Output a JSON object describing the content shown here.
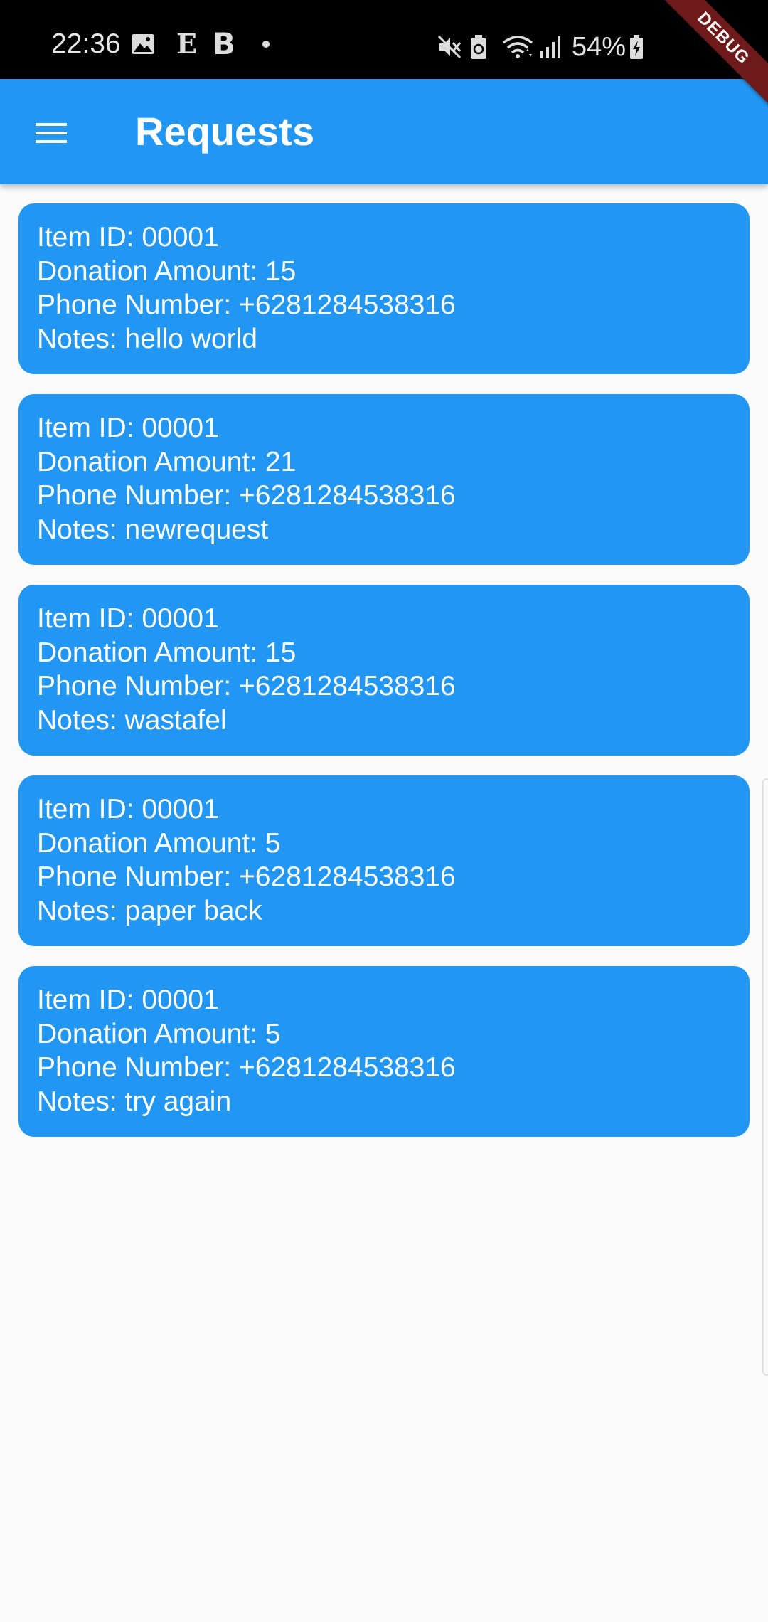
{
  "status_bar": {
    "time": "22:36",
    "left_icons": [
      "image-icon",
      "e-app-icon",
      "b-app-icon",
      "notification-dot-icon"
    ],
    "e_glyph": "E",
    "b_glyph": "B",
    "right_icons": [
      "mute-icon",
      "battery-saver-icon",
      "wifi-icon",
      "signal-icon",
      "battery-charging-icon"
    ],
    "battery_percent": "54%"
  },
  "debug_banner": "DEBUG",
  "app_bar": {
    "title": "Requests",
    "menu_icon": "menu-icon"
  },
  "requests": [
    {
      "item_id": "Item ID: 00001",
      "donation_amount": "Donation Amount: 15",
      "phone_number": "Phone Number: +6281284538316",
      "notes": "Notes: hello world"
    },
    {
      "item_id": "Item ID: 00001",
      "donation_amount": "Donation Amount: 21",
      "phone_number": "Phone Number: +6281284538316",
      "notes": "Notes: newrequest"
    },
    {
      "item_id": "Item ID: 00001",
      "donation_amount": "Donation Amount: 15",
      "phone_number": "Phone Number: +6281284538316",
      "notes": "Notes: wastafel"
    },
    {
      "item_id": "Item ID: 00001",
      "donation_amount": "Donation Amount: 5",
      "phone_number": "Phone Number: +6281284538316",
      "notes": "Notes: paper back"
    },
    {
      "item_id": "Item ID: 00001",
      "donation_amount": "Donation Amount: 5",
      "phone_number": "Phone Number: +6281284538316",
      "notes": "Notes: try again"
    }
  ],
  "colors": {
    "app_bar": "#2196f3",
    "card": "#2196f3",
    "status_bar": "#000000",
    "background": "#fafafa",
    "debug_ribbon": "#6e1a1a"
  }
}
